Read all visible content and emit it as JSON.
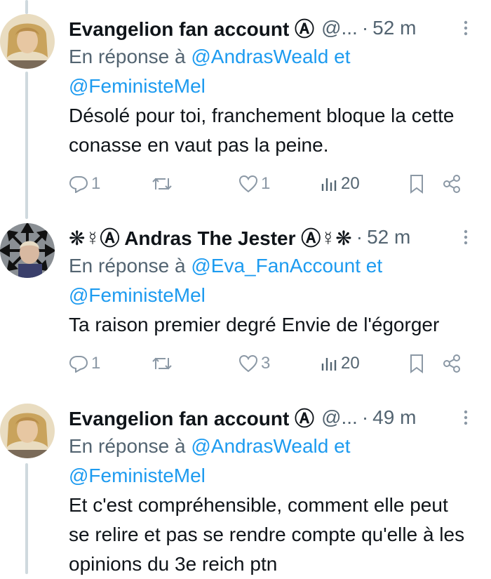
{
  "tweets": [
    {
      "display_name": "Evangelion fan account Ⓐ",
      "handle": "@...",
      "dot": "·",
      "time": "52 m",
      "reply_prefix": "En réponse à ",
      "reply_mention_1": "@AndrasWeald",
      "reply_and": " et ",
      "reply_mention_2": "@FeministeMel",
      "text": "Désolé pour toi, franchement bloque la cette conasse en vaut pas la peine.",
      "replies": "1",
      "retweets": "",
      "likes": "1",
      "views": "20"
    },
    {
      "display_name": "❋☿Ⓐ Andras The Jester Ⓐ☿❋",
      "handle": "",
      "dot": "·",
      "time": "52 m",
      "reply_prefix": "En réponse à ",
      "reply_mention_1": "@Eva_FanAccount",
      "reply_and": " et ",
      "reply_mention_2": "@FeministeMel",
      "text": "Ta raison premier degré Envie de l'égorger",
      "replies": "1",
      "retweets": "",
      "likes": "3",
      "views": "20"
    },
    {
      "display_name": "Evangelion fan account Ⓐ",
      "handle": "@...",
      "dot": "·",
      "time": "49 m",
      "reply_prefix": "En réponse à ",
      "reply_mention_1": "@AndrasWeald",
      "reply_and": " et ",
      "reply_mention_2": "@FeministeMel",
      "text": "Et c'est compréhensible, comment elle peut se relire et pas se rendre compte qu'elle à les opinions du 3e reich ptn",
      "replies": "",
      "retweets": "",
      "likes": "",
      "views": ""
    }
  ],
  "icons": {
    "reply": "reply-icon",
    "retweet": "retweet-icon",
    "like": "heart-icon",
    "views": "views-icon",
    "bookmark": "bookmark-icon",
    "share": "share-icon",
    "more": "more-icon"
  },
  "colors": {
    "mention": "#1d9bf0",
    "secondary": "#536471",
    "thread_line": "#cfd9de"
  }
}
